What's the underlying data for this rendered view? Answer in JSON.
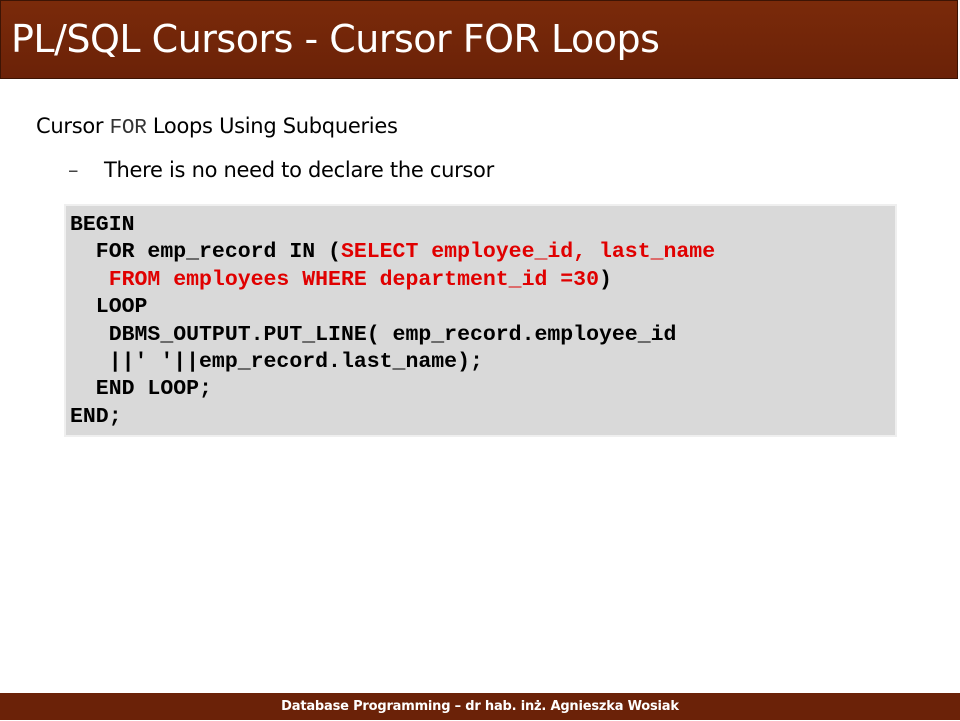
{
  "slide": {
    "title": "PL/SQL Cursors - Cursor FOR Loops",
    "heading_pre": "Cursor ",
    "heading_code": "FOR",
    "heading_post": " Loops Using Subqueries",
    "bullet_dash": "–",
    "bullet_text": "There is no need to declare the cursor"
  },
  "code": {
    "l1": "BEGIN",
    "l2_a": "  FOR emp_record IN (",
    "l2_b": "SELECT employee_id, last_name",
    "l3_a": "   FROM employees WHERE department_id =30",
    "l3_b": ")",
    "l4": "  LOOP",
    "l5": "   DBMS_OUTPUT.PUT_LINE( emp_record.employee_id",
    "l6": "   ||' '||emp_record.last_name);",
    "l7": "  END LOOP;",
    "l8": "END;"
  },
  "footer": {
    "text": "Database Programming – dr hab. inż. Agnieszka Wosiak"
  },
  "colors": {
    "title_bar": "#6b2208",
    "code_background": "#d9d9d9",
    "highlight": "#e00000"
  }
}
